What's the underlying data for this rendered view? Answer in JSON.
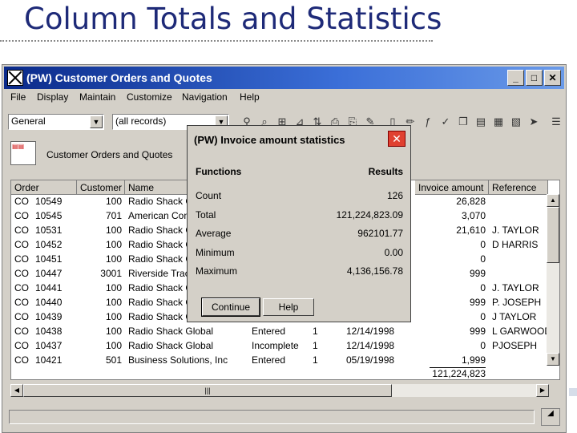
{
  "slide": {
    "title": "Column Totals and Statistics"
  },
  "window": {
    "title": "(PW) Customer Orders and Quotes",
    "controls": {
      "minimize": "_",
      "maximize": "□",
      "close": "✕"
    }
  },
  "menu": [
    "File",
    "Display",
    "Maintain",
    "Customize",
    "Navigation",
    "Help"
  ],
  "toolbar": {
    "view_select": "General",
    "filter_select": "(all records)"
  },
  "page_label": "Customer Orders and Quotes",
  "table": {
    "headers": [
      "Order",
      "Customer",
      "Name",
      "Invoice amount",
      "Reference"
    ],
    "rows": [
      {
        "type": "CO",
        "order": "10549",
        "cust": "100",
        "name": "Radio Shack G",
        "status": "",
        "n": "",
        "date": "",
        "amount": "26,828",
        "ref": ""
      },
      {
        "type": "CO",
        "order": "10545",
        "cust": "701",
        "name": "American Com",
        "status": "",
        "n": "",
        "date": "",
        "amount": "3,070",
        "ref": ""
      },
      {
        "type": "CO",
        "order": "10531",
        "cust": "100",
        "name": "Radio Shack G",
        "status": "",
        "n": "",
        "date": "",
        "amount": "21,610",
        "ref": "J. TAYLOR"
      },
      {
        "type": "CO",
        "order": "10452",
        "cust": "100",
        "name": "Radio Shack G",
        "status": "",
        "n": "",
        "date": "",
        "amount": "0",
        "ref": "D HARRIS"
      },
      {
        "type": "CO",
        "order": "10451",
        "cust": "100",
        "name": "Radio Shack G",
        "status": "",
        "n": "",
        "date": "",
        "amount": "0",
        "ref": ""
      },
      {
        "type": "CO",
        "order": "10447",
        "cust": "3001",
        "name": "Riverside Trac",
        "status": "",
        "n": "",
        "date": "",
        "amount": "999",
        "ref": ""
      },
      {
        "type": "CO",
        "order": "10441",
        "cust": "100",
        "name": "Radio Shack G",
        "status": "",
        "n": "",
        "date": "",
        "amount": "0",
        "ref": "J. TAYLOR"
      },
      {
        "type": "CO",
        "order": "10440",
        "cust": "100",
        "name": "Radio Shack G",
        "status": "",
        "n": "",
        "date": "",
        "amount": "999",
        "ref": "P. JOSEPH"
      },
      {
        "type": "CO",
        "order": "10439",
        "cust": "100",
        "name": "Radio Shack G",
        "status": "",
        "n": "",
        "date": "",
        "amount": "0",
        "ref": "J TAYLOR"
      },
      {
        "type": "CO",
        "order": "10438",
        "cust": "100",
        "name": "Radio Shack Global",
        "status": "Entered",
        "n": "1",
        "date": "12/14/1998",
        "amount": "999",
        "ref": "L GARWOOD"
      },
      {
        "type": "CO",
        "order": "10437",
        "cust": "100",
        "name": "Radio Shack Global",
        "status": "Incomplete",
        "n": "1",
        "date": "12/14/1998",
        "amount": "0",
        "ref": "PJOSEPH"
      },
      {
        "type": "CO",
        "order": "10421",
        "cust": "501",
        "name": "Business Solutions, Inc",
        "status": "Entered",
        "n": "1",
        "date": "05/19/1998",
        "amount": "1,999",
        "ref": ""
      }
    ],
    "total": "121,224,823"
  },
  "dialog": {
    "title": "(PW) Invoice amount statistics",
    "col_functions": "Functions",
    "col_results": "Results",
    "stats": [
      {
        "label": "Count",
        "value": "126"
      },
      {
        "label": "Total",
        "value": "121,224,823.09"
      },
      {
        "label": "Average",
        "value": "962101.77"
      },
      {
        "label": "Minimum",
        "value": "0.00"
      },
      {
        "label": "Maximum",
        "value": "4,136,156.78"
      }
    ],
    "continue_label": "Continue",
    "help_label": "Help"
  }
}
